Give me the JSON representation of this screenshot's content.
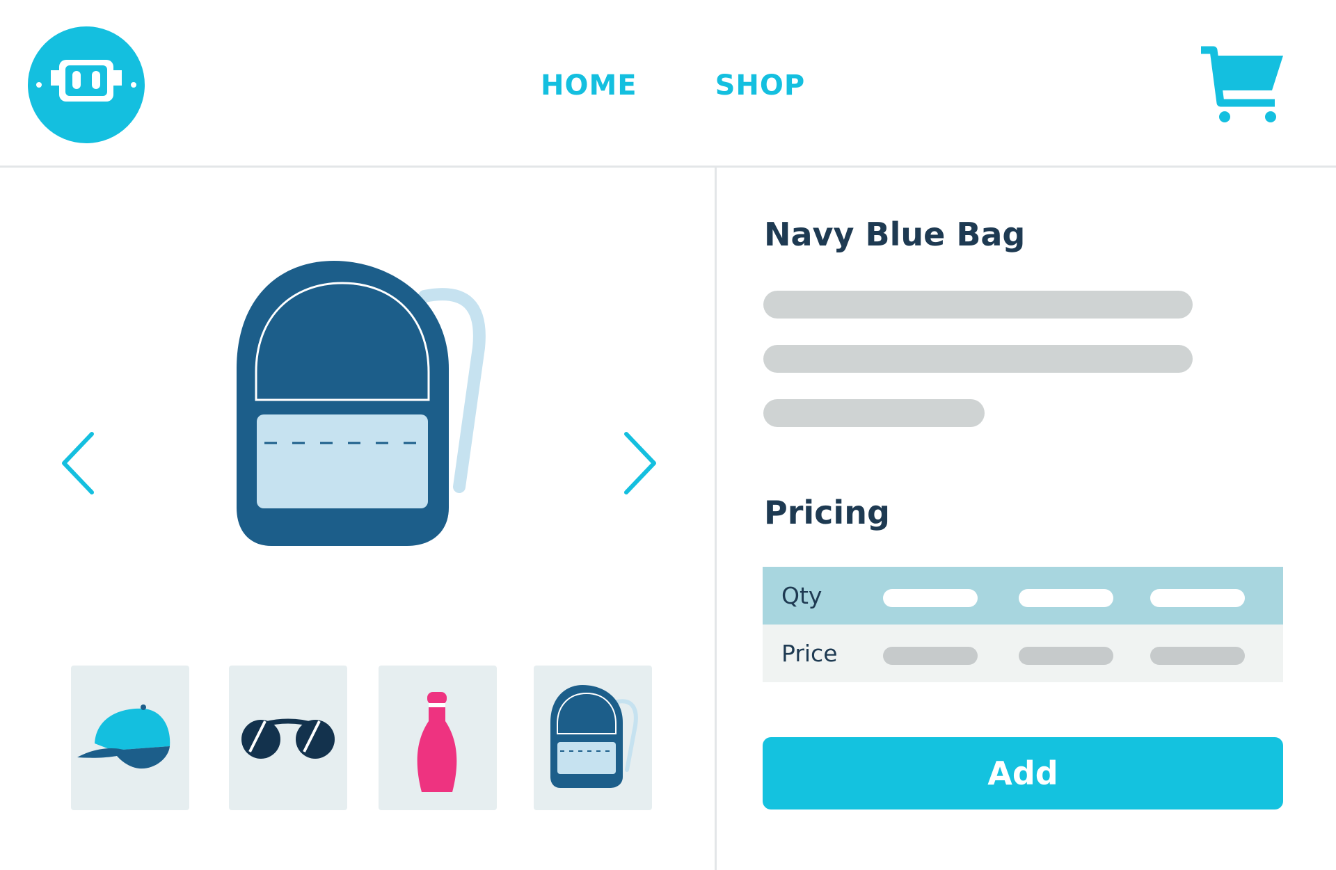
{
  "colors": {
    "accent": "#14bfdf",
    "navy": "#1c5e8a",
    "text_dark": "#1e3a52",
    "light_blue": "#c6e2f0",
    "pink": "#ee3380",
    "placeholder_gray": "#cfd3d3",
    "table_header": "#a8d6df"
  },
  "header": {
    "logo_icon": "robot-face-icon",
    "nav": [
      {
        "label": "HOME"
      },
      {
        "label": "SHOP"
      }
    ],
    "cart_icon": "shopping-cart-icon"
  },
  "gallery": {
    "main_image_icon": "backpack-icon",
    "prev_icon": "chevron-left-icon",
    "next_icon": "chevron-right-icon",
    "thumbnails": [
      {
        "icon": "cap-icon"
      },
      {
        "icon": "sunglasses-icon"
      },
      {
        "icon": "bottle-icon"
      },
      {
        "icon": "backpack-icon"
      }
    ]
  },
  "product": {
    "title": "Navy Blue Bag",
    "pricing_heading": "Pricing",
    "pricing_table": {
      "qty_label": "Qty",
      "price_label": "Price"
    },
    "add_button_label": "Add"
  }
}
